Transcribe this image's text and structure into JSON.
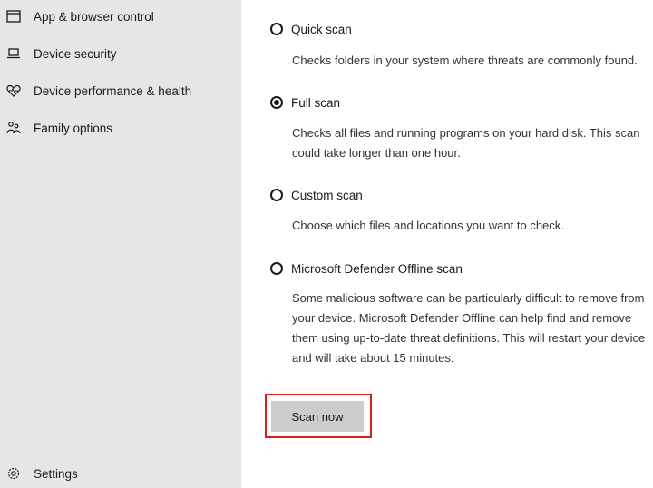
{
  "sidebar": {
    "items": [
      {
        "label": "App & browser control",
        "icon": "browser-window-icon"
      },
      {
        "label": "Device security",
        "icon": "laptop-icon"
      },
      {
        "label": "Device performance & health",
        "icon": "heart-pulse-icon"
      },
      {
        "label": "Family options",
        "icon": "family-icon"
      }
    ],
    "settings": {
      "label": "Settings",
      "icon": "gear-icon"
    }
  },
  "scan_options": [
    {
      "label": "Quick scan",
      "checked": false,
      "description": "Checks folders in your system where threats are commonly found."
    },
    {
      "label": "Full scan",
      "checked": true,
      "description": "Checks all files and running programs on your hard disk. This scan could take longer than one hour."
    },
    {
      "label": "Custom scan",
      "checked": false,
      "description": "Choose which files and locations you want to check."
    },
    {
      "label": "Microsoft Defender Offline scan",
      "checked": false,
      "description": "Some malicious software can be particularly difficult to remove from your device. Microsoft Defender Offline can help find and remove them using up-to-date threat definitions. This will restart your device and will take about 15 minutes."
    }
  ],
  "scan_button": {
    "label": "Scan now"
  },
  "colors": {
    "sidebar_bg": "#e6e6e6",
    "highlight": "#d61f1f",
    "button_bg": "#cccccc"
  }
}
